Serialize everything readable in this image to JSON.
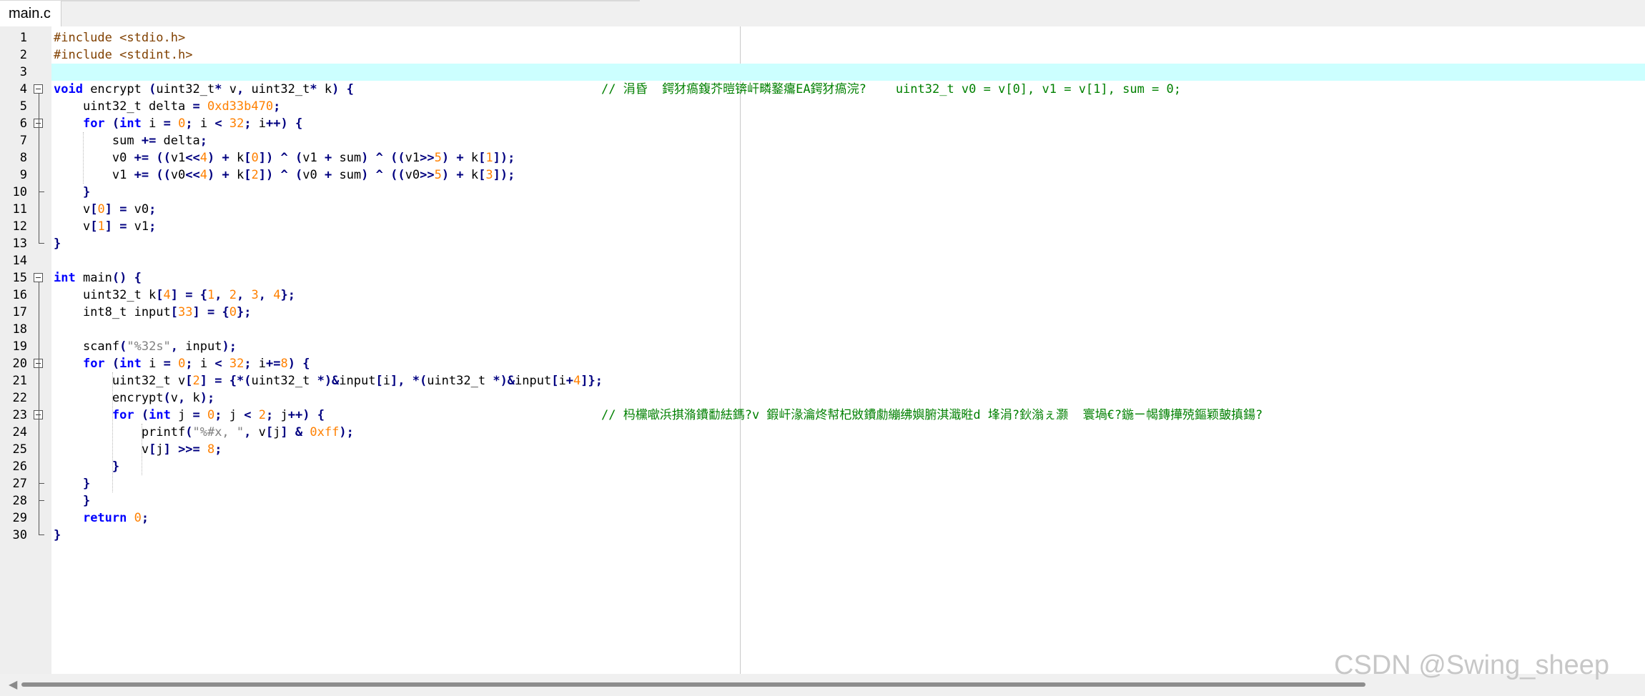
{
  "tab": {
    "label": "main.c"
  },
  "lines": [
    {
      "n": "1",
      "code": "#include <stdio.h>",
      "comment": "",
      "hl": false,
      "fold": false
    },
    {
      "n": "2",
      "code": "#include <stdint.h>",
      "comment": "",
      "hl": false,
      "fold": false
    },
    {
      "n": "3",
      "code": "",
      "comment": "",
      "hl": true,
      "fold": false
    },
    {
      "n": "4",
      "code": "void encrypt (uint32_t* v, uint32_t* k) {",
      "comment": "// 涓昏  鍔犲瘑鍑芥暟锛屽疄鐜癟EA鍔犲瘑浣?    uint32_t v0 = v[0], v1 = v[1], sum = 0;",
      "hl": false,
      "fold": true
    },
    {
      "n": "5",
      "code": "    uint32_t delta = 0xd33b470;",
      "comment": "",
      "hl": false,
      "fold": false
    },
    {
      "n": "6",
      "code": "    for (int i = 0; i < 32; i++) {",
      "comment": "",
      "hl": false,
      "fold": true
    },
    {
      "n": "7",
      "code": "        sum += delta;",
      "comment": "",
      "hl": false,
      "fold": false
    },
    {
      "n": "8",
      "code": "        v0 += ((v1<<4) + k[0]) ^ (v1 + sum) ^ ((v1>>5) + k[1]);",
      "comment": "",
      "hl": false,
      "fold": false
    },
    {
      "n": "9",
      "code": "        v1 += ((v0<<4) + k[2]) ^ (v0 + sum) ^ ((v0>>5) + k[3]);",
      "comment": "",
      "hl": false,
      "fold": false
    },
    {
      "n": "10",
      "code": "    }",
      "comment": "",
      "hl": false,
      "fold": false
    },
    {
      "n": "11",
      "code": "    v[0] = v0;",
      "comment": "",
      "hl": false,
      "fold": false
    },
    {
      "n": "12",
      "code": "    v[1] = v1;",
      "comment": "",
      "hl": false,
      "fold": false
    },
    {
      "n": "13",
      "code": "}",
      "comment": "",
      "hl": false,
      "fold": false
    },
    {
      "n": "14",
      "code": "",
      "comment": "",
      "hl": false,
      "fold": false
    },
    {
      "n": "15",
      "code": "int main() {",
      "comment": "",
      "hl": false,
      "fold": true
    },
    {
      "n": "16",
      "code": "    uint32_t k[4] = {1, 2, 3, 4};",
      "comment": "",
      "hl": false,
      "fold": false
    },
    {
      "n": "17",
      "code": "    int8_t input[33] = {0};",
      "comment": "",
      "hl": false,
      "fold": false
    },
    {
      "n": "18",
      "code": "",
      "comment": "",
      "hl": false,
      "fold": false
    },
    {
      "n": "19",
      "code": "    scanf(\"%32s\", input);",
      "comment": "",
      "hl": false,
      "fold": false
    },
    {
      "n": "20",
      "code": "    for (int i = 0; i < 32; i+=8) {",
      "comment": "",
      "hl": false,
      "fold": true
    },
    {
      "n": "21",
      "code": "        uint32_t v[2] = {*(uint32_t *)&input[i], *(uint32_t *)&input[i+4]};",
      "comment": "",
      "hl": false,
      "fold": false
    },
    {
      "n": "22",
      "code": "        encrypt(v, k);",
      "comment": "",
      "hl": false,
      "fold": false
    },
    {
      "n": "23",
      "code": "        for (int j = 0; j < 2; j++) {",
      "comment": "// 杩欓噷浜掑潃鐨勫紶鎷?v 鍜屽湪瀹炵幇杞敓鐨勮繃绋嬩腑淇濈暀d 埄涓?鈥滃ぇ灏  寰堝€?鍦ㄧ幆鏄撶殑鏂颖皷搷鍚?",
      "hl": false,
      "fold": true
    },
    {
      "n": "24",
      "code": "            printf(\"%#x, \", v[j] & 0xff);",
      "comment": "",
      "hl": false,
      "fold": false
    },
    {
      "n": "25",
      "code": "            v[j] >>= 8;",
      "comment": "",
      "hl": false,
      "fold": false
    },
    {
      "n": "26",
      "code": "        }",
      "comment": "",
      "hl": false,
      "fold": false
    },
    {
      "n": "27",
      "code": "    }",
      "comment": "",
      "hl": false,
      "fold": false
    },
    {
      "n": "28",
      "code": "    }",
      "comment": "",
      "hl": false,
      "fold": false
    },
    {
      "n": "29",
      "code": "    return 0;",
      "comment": "",
      "hl": false,
      "fold": false
    },
    {
      "n": "30",
      "code": "}",
      "comment": "",
      "hl": false,
      "fold": false
    }
  ],
  "scrollbar": {
    "left_arrow": "◀"
  },
  "watermark": "CSDN @Swing_sheep",
  "colors": {
    "current_line": "#ccffff",
    "keyword": "#0000ff",
    "preprocessor": "#804000",
    "operator": "#000080",
    "number": "#ff8000",
    "string": "#808080",
    "comment": "#008000"
  }
}
